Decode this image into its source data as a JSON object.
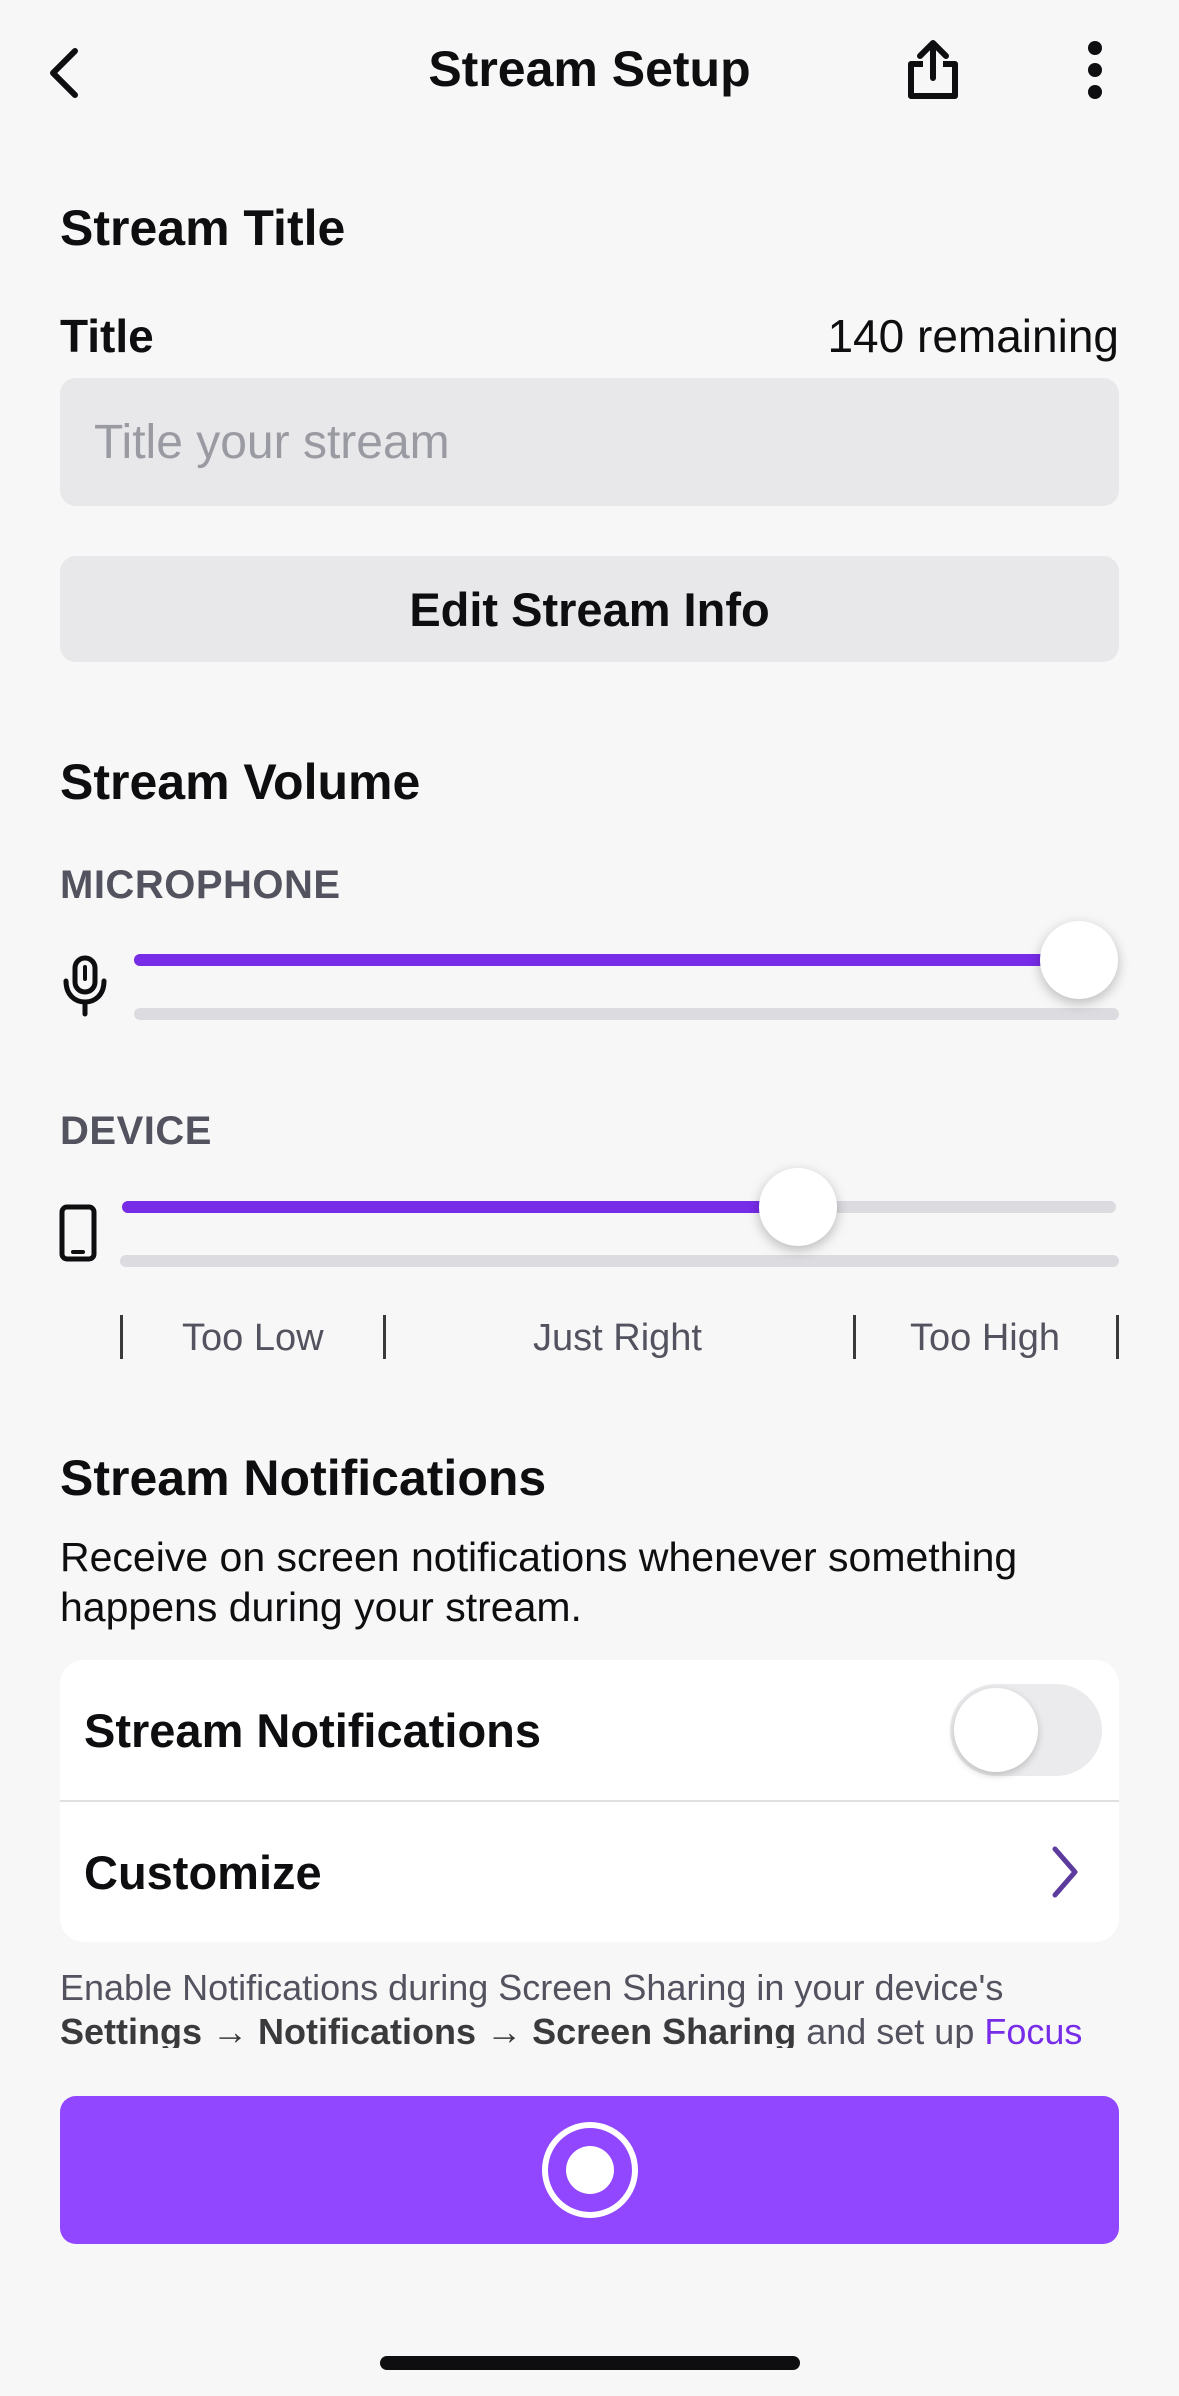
{
  "header": {
    "title": "Stream Setup",
    "back_icon": "chevron-left-icon",
    "share_icon": "share-icon",
    "more_icon": "more-vertical-icon"
  },
  "stream_title": {
    "section": "Stream Title",
    "label": "Title",
    "remaining": "140 remaining",
    "value": "",
    "placeholder": "Title your stream",
    "edit_button": "Edit Stream Info"
  },
  "volume": {
    "section": "Stream Volume",
    "microphone": {
      "label": "MICROPHONE",
      "icon": "microphone-icon",
      "level": 1.0
    },
    "device": {
      "label": "DEVICE",
      "icon": "phone-icon",
      "level": 0.68
    },
    "scale": [
      "Too Low",
      "Just Right",
      "Too High"
    ]
  },
  "notifications": {
    "section": "Stream Notifications",
    "description": "Receive on screen notifications whenever something happens during your stream.",
    "toggle_label": "Stream Notifications",
    "toggle_on": false,
    "customize_label": "Customize",
    "footnote": {
      "prefix": "Enable Notifications during Screen Sharing in your device's",
      "path1": "Settings",
      "arrow": "→",
      "path2": "Notifications",
      "path3": "Screen Sharing",
      "middle": "and set up",
      "link": "Focus"
    }
  },
  "go_live": {
    "icon": "record-icon"
  },
  "colors": {
    "accent": "#772ce8",
    "button": "#9147ff",
    "background": "#f7f7f8"
  }
}
